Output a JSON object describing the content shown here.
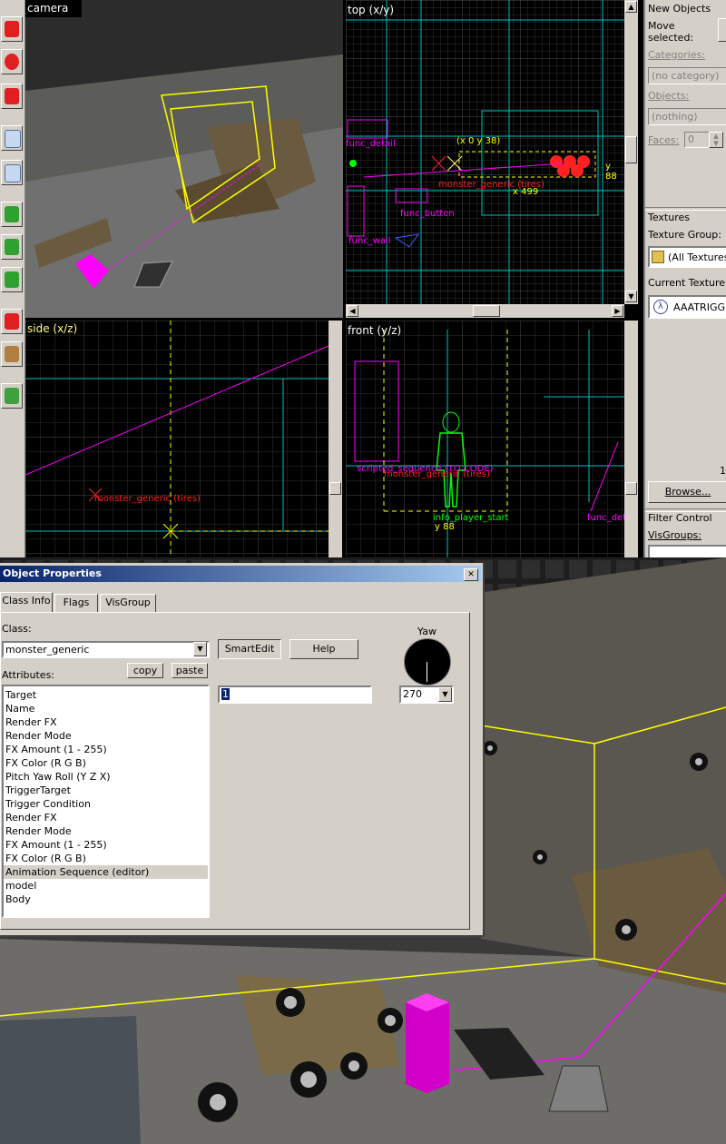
{
  "viewports": {
    "camera": "camera",
    "top": "top (x/y)",
    "side": "side (x/z)",
    "front": "front (y/z)"
  },
  "top_labels": {
    "func_detail": "func_detail",
    "coord": "(x 0 y 38)",
    "monster": "monster_generic (tires)",
    "y88": "y 88",
    "x499": "x 499",
    "func_button": "func_button",
    "func_wall": "func_wall"
  },
  "side_labels": {
    "monster": "monster_generic (tires)"
  },
  "front_labels": {
    "scripted": "scripted_sequence (TO CODE)",
    "monster": "monster_generic (tires)",
    "player": "info_player_start",
    "y88": "y 88",
    "func_det": "func_det"
  },
  "panel": {
    "new_objects": "New Objects",
    "move": "Move",
    "selected": "selected:",
    "categories": "Categories:",
    "no_category": "(no category)",
    "objects": "Objects:",
    "nothing": "(nothing)",
    "faces": "Faces:",
    "faces_value": "0",
    "textures": "Textures",
    "texture_group": "Texture Group:",
    "all_textures": "(All Textures)",
    "current_texture": "Current Texture:",
    "texture_name": "AAATRIGGER",
    "browse": "Browse...",
    "filter_control": "Filter Control",
    "visgroups": "VisGroups:",
    "stray": "1"
  },
  "dialog": {
    "title": "Object Properties",
    "close": "✕",
    "tabs": [
      "Class Info",
      "Flags",
      "VisGroup"
    ],
    "class_label": "Class:",
    "class_value": "monster_generic",
    "smartedit": "SmartEdit",
    "help": "Help",
    "yaw_label": "Yaw",
    "attributes_label": "Attributes:",
    "copy": "copy",
    "paste": "paste",
    "value_field": "1",
    "yaw_value": "270",
    "attributes": [
      "Target",
      "Name",
      "Render FX",
      "Render Mode",
      "FX Amount (1 - 255)",
      "FX Color (R G B)",
      "Pitch Yaw Roll (Y Z X)",
      "TriggerTarget",
      "Trigger Condition",
      "Render FX",
      "Render Mode",
      "FX Amount (1 - 255)",
      "FX Color (R G B)",
      "Animation Sequence (editor)",
      "model",
      "Body"
    ],
    "selected_index": 13
  },
  "colors": {
    "accent_title": "#0a246a",
    "selection": "#ffff00",
    "entity_magenta": "#ff00ff",
    "monster_red": "#ff0000",
    "player_green": "#00ff00",
    "brush_cyan": "#00ffff"
  },
  "icons": [
    "select-arrow-icon",
    "magnify-icon",
    "camera-icon",
    "light-icon",
    "cube-icon",
    "green-cube-icon",
    "green-cube2-icon",
    "green-cube3-icon",
    "red-decal-icon",
    "gear-icon",
    "truck-icon"
  ]
}
